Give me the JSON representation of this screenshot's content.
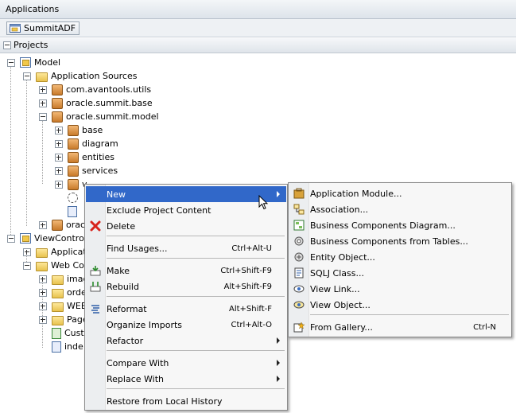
{
  "window": {
    "title": "Applications"
  },
  "app_selector": {
    "value": "SummitADF"
  },
  "projects_panel": {
    "title": "Projects"
  },
  "tree": [
    {
      "label": "Model"
    },
    {
      "label": "Application Sources"
    },
    {
      "label": "com.avantools.utils"
    },
    {
      "label": "oracle.summit.base"
    },
    {
      "label": "oracle.summit.model"
    },
    {
      "label": "base"
    },
    {
      "label": "diagram"
    },
    {
      "label": "entities"
    },
    {
      "label": "services"
    },
    {
      "label": "v"
    },
    {
      "label": ""
    },
    {
      "label": ""
    },
    {
      "label": "orac"
    },
    {
      "label": "ViewControlle"
    },
    {
      "label": "Applicati"
    },
    {
      "label": "Web Con"
    },
    {
      "label": "imag"
    },
    {
      "label": "orde"
    },
    {
      "label": "WEB"
    },
    {
      "label": "Page"
    },
    {
      "label": "Cust"
    },
    {
      "label": "inde"
    }
  ],
  "context_menu": {
    "items": [
      {
        "label": "New",
        "accel": "",
        "submenu": true,
        "selected": true,
        "icon": ""
      },
      {
        "label": "Exclude Project Content",
        "accel": "",
        "submenu": false,
        "icon": ""
      },
      {
        "label": "Delete",
        "accel": "",
        "submenu": false,
        "icon": "delete-icon"
      },
      {
        "label": "Find Usages...",
        "accel": "Ctrl+Alt-U",
        "submenu": false,
        "icon": ""
      },
      {
        "label": "Make",
        "accel": "Ctrl+Shift-F9",
        "submenu": false,
        "icon": "make-icon"
      },
      {
        "label": "Rebuild",
        "accel": "Alt+Shift-F9",
        "submenu": false,
        "icon": "rebuild-icon"
      },
      {
        "label": "Reformat",
        "accel": "Alt+Shift-F",
        "submenu": false,
        "icon": "reformat-icon"
      },
      {
        "label": "Organize Imports",
        "accel": "Ctrl+Alt-O",
        "submenu": false,
        "icon": ""
      },
      {
        "label": "Refactor",
        "accel": "",
        "submenu": true,
        "icon": ""
      },
      {
        "label": "Compare With",
        "accel": "",
        "submenu": true,
        "icon": ""
      },
      {
        "label": "Replace With",
        "accel": "",
        "submenu": true,
        "icon": ""
      },
      {
        "label": "Restore from Local History",
        "accel": "",
        "submenu": false,
        "icon": ""
      }
    ]
  },
  "new_submenu": {
    "items": [
      {
        "label": "Application Module...",
        "accel": ""
      },
      {
        "label": "Association...",
        "accel": ""
      },
      {
        "label": "Business Components Diagram...",
        "accel": ""
      },
      {
        "label": "Business Components from Tables...",
        "accel": ""
      },
      {
        "label": "Entity Object...",
        "accel": ""
      },
      {
        "label": "SQLJ Class...",
        "accel": ""
      },
      {
        "label": "View Link...",
        "accel": ""
      },
      {
        "label": "View Object...",
        "accel": ""
      },
      {
        "label": "From Gallery...",
        "accel": "Ctrl-N"
      }
    ]
  },
  "colors": {
    "selection": "#3168c9",
    "menu_bg": "#f7f7f7"
  }
}
